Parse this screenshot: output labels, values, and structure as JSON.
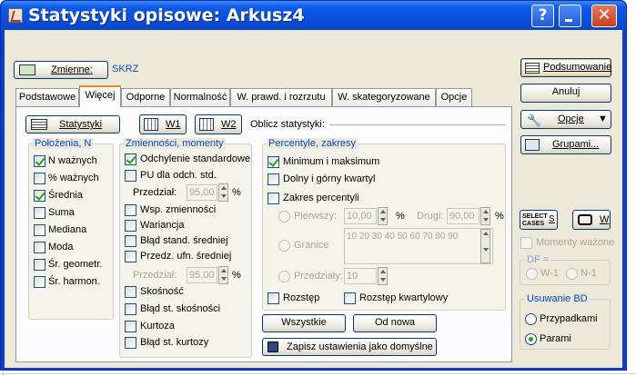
{
  "window": {
    "title": "Statystyki opisowe: Arkusz4"
  },
  "titlebar": {
    "help": "?",
    "minimize": "",
    "close": "✕"
  },
  "variables": {
    "button_label": "Zmienne:",
    "value": "SKRZ"
  },
  "tabs": [
    {
      "label": "Podstawowe",
      "active": false
    },
    {
      "label": "Więcej",
      "active": true
    },
    {
      "label": "Odporne",
      "active": false
    },
    {
      "label": "Normalność",
      "active": false
    },
    {
      "label": "W. prawd. i rozrzutu",
      "active": false
    },
    {
      "label": "W. skategoryzowane",
      "active": false
    },
    {
      "label": "Opcje",
      "active": false
    }
  ],
  "toolbar": {
    "statystyki": "Statystyki",
    "w1": "W1",
    "w2": "W2",
    "oblicz": "Oblicz statystyki:"
  },
  "polozenia": {
    "title": "Położenia, N",
    "items": [
      {
        "label": "N ważnych",
        "checked": true
      },
      {
        "label": "% ważnych",
        "checked": false
      },
      {
        "label": "Średnia",
        "checked": true
      },
      {
        "label": "Suma",
        "checked": false
      },
      {
        "label": "Mediana",
        "checked": false
      },
      {
        "label": "Moda",
        "checked": false
      },
      {
        "label": "Śr. geometr.",
        "checked": false
      },
      {
        "label": "Śr. harmon.",
        "checked": false
      }
    ]
  },
  "zmiennosci": {
    "title": "Zmienności, momenty",
    "odch": {
      "label": "Odchylenie standardowe",
      "checked": true
    },
    "pu": {
      "label": "PU dla odch. std.",
      "checked": false
    },
    "przedzial1": {
      "label": "Przedział:",
      "value": "95,00",
      "unit": "%"
    },
    "items": [
      {
        "label": "Wsp. zmienności",
        "checked": false
      },
      {
        "label": "Wariancja",
        "checked": false
      },
      {
        "label": "Błąd stand. średniej",
        "checked": false
      },
      {
        "label": "Przedz. ufn. średniej",
        "checked": false
      }
    ],
    "przedzial2": {
      "label": "Przedział:",
      "value": "95,00",
      "unit": "%"
    },
    "items2": [
      {
        "label": "Skośność",
        "checked": false
      },
      {
        "label": "Błąd st. skośności",
        "checked": false
      },
      {
        "label": "Kurtoza",
        "checked": false
      },
      {
        "label": "Błąd st. kurtozy",
        "checked": false
      }
    ]
  },
  "percentyle": {
    "title": "Percentyle, zakresy",
    "minmax": {
      "label": "Minimum i maksimum",
      "checked": true
    },
    "kwartyl": {
      "label": "Dolny i górny kwartyl",
      "checked": false
    },
    "zakres": {
      "label": "Zakres percentyli",
      "checked": false
    },
    "pierwszy": {
      "label": "Pierwszy:",
      "value": "10,00",
      "unit": "%"
    },
    "drugi": {
      "label": "Drugi:",
      "value": "90,00",
      "unit": "%"
    },
    "granice": {
      "label": "Granice",
      "value": "10 20 30 40 50 60 70 80 90"
    },
    "przedzialy": {
      "label": "Przedziały:",
      "value": "10"
    },
    "rozstep": {
      "label": "Rozstęp",
      "checked": false
    },
    "rozstep_kw": {
      "label": "Rozstęp kwartylowy",
      "checked": false
    }
  },
  "bottom": {
    "wszystkie": "Wszystkie",
    "od_nowa": "Od nowa",
    "zapisz": "Zapisz ustawienia jako domyślne"
  },
  "right": {
    "podsumowanie": "Podsumowanie",
    "anuluj": "Anuluj",
    "opcje": "Opcje",
    "grupami": "Grupami...",
    "select_cases_1": "SELECT",
    "select_cases_2": "CASES",
    "s": "S",
    "w": "W",
    "momenty": {
      "label": "Momenty ważone",
      "checked": false
    },
    "df": {
      "title": "DF =",
      "opt1": "W-1",
      "opt2": "N-1"
    },
    "usuwanie": {
      "title": "Usuwanie BD",
      "opt1": "Przypadkami",
      "opt2": "Parami",
      "selected": "Parami"
    }
  }
}
